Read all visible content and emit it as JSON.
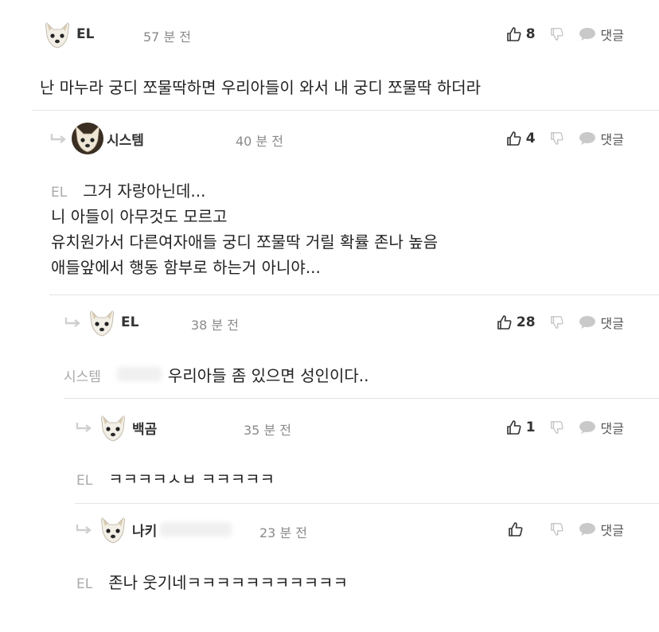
{
  "actions": {
    "reply_label": "댓글"
  },
  "comments": [
    {
      "nick": "EL",
      "time": "57 분 전",
      "likes": "8",
      "body": "난 마누라 궁디 쪼물딱하면 우리아들이 와서 내 궁디 쪼물딱 하더라"
    },
    {
      "nick": "시스템",
      "time": "40 분 전",
      "likes": "4",
      "mention": "EL",
      "body_lines": [
        "그거 자랑아닌데...",
        "니 아들이 아무것도 모르고",
        "유치원가서 다른여자애들 궁디 쪼물딱 거릴 확률 존나 높음",
        "애들앞에서 행동 함부로 하는거 아니야..."
      ]
    },
    {
      "nick": "EL",
      "time": "38 분 전",
      "likes": "28",
      "mention": "시스템",
      "body": "우리아들 좀 있으면 성인이다.."
    },
    {
      "nick": "백곰",
      "time": "35 분 전",
      "likes": "1",
      "mention": "EL",
      "body": "ㅋㅋㅋㅋㅅㅂ ㅋㅋㅋㅋㅋ"
    },
    {
      "nick": "나키",
      "time": "23 분 전",
      "likes": "",
      "mention": "EL",
      "body": "존나 웃기네ㅋㅋㅋㅋㅋㅋㅋㅋㅋㅋㅋ"
    }
  ]
}
